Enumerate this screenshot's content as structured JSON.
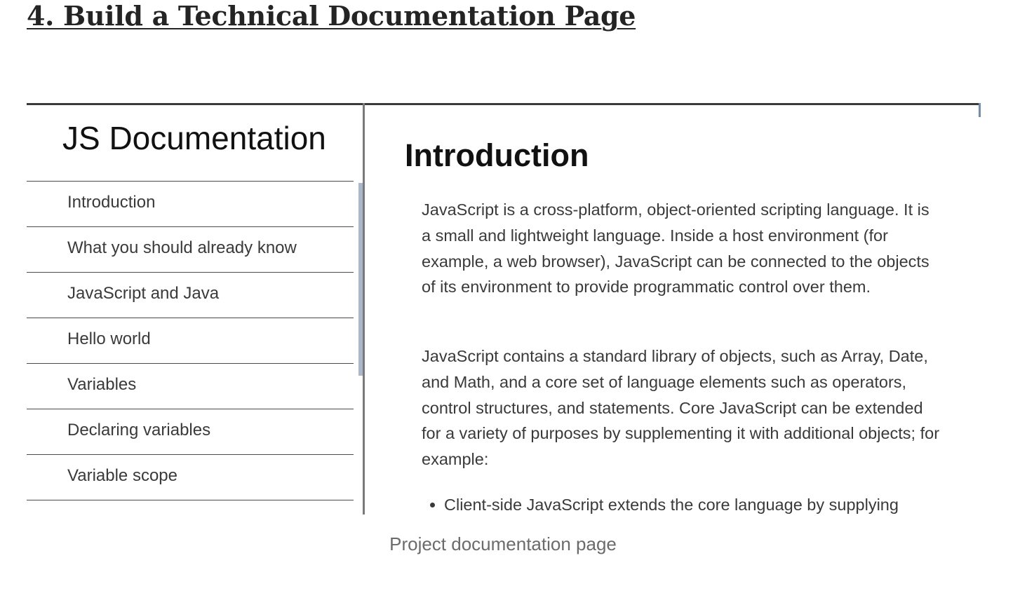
{
  "article": {
    "heading": "4. Build a Technical Documentation Page",
    "caption": "Project documentation page"
  },
  "nav": {
    "title": "JS Documentation",
    "items": [
      {
        "label": "Introduction"
      },
      {
        "label": "What you should already know"
      },
      {
        "label": "JavaScript and Java"
      },
      {
        "label": "Hello world"
      },
      {
        "label": "Variables"
      },
      {
        "label": "Declaring variables"
      },
      {
        "label": "Variable scope"
      }
    ]
  },
  "main": {
    "title": "Introduction",
    "paragraphs": [
      "JavaScript is a cross-platform, object-oriented scripting language. It is a small and lightweight language. Inside a host environment (for example, a web browser), JavaScript can be connected to the objects of its environment to provide programmatic control over them.",
      "JavaScript contains a standard library of objects, such as Array, Date, and Math, and a core set of language elements such as operators, control structures, and statements. Core JavaScript can be extended for a variety of purposes by supplementing it with additional objects; for example:"
    ],
    "bullets": [
      "Client-side JavaScript extends the core language by supplying"
    ]
  }
}
